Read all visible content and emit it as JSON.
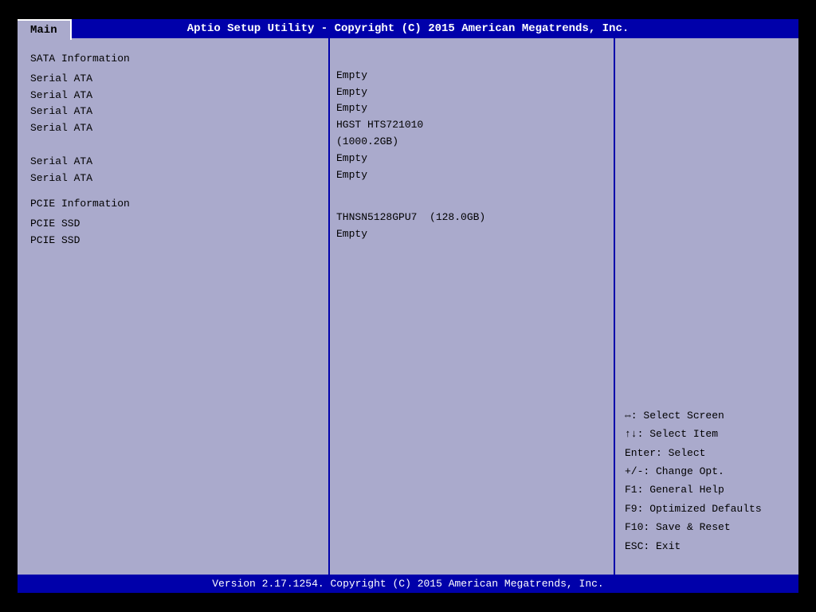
{
  "header": {
    "title": "Aptio Setup Utility - Copyright (C) 2015 American Megatrends, Inc.",
    "tab_main": "Main"
  },
  "footer": {
    "text": "Version 2.17.1254. Copyright (C) 2015 American Megatrends, Inc."
  },
  "left_panel": {
    "sata_section": "SATA Information",
    "sata_ports": [
      "Serial ATA",
      "Serial ATA",
      "Serial ATA",
      "Serial ATA",
      "",
      "Serial ATA",
      "Serial ATA"
    ],
    "pcie_section": "PCIE Information",
    "pcie_ports": [
      "PCIE SSD",
      "PCIE SSD"
    ]
  },
  "center_panel": {
    "sata_values": [
      "Empty",
      "Empty",
      "Empty",
      "HGST HTS721010",
      "(1000.2GB)",
      "Empty",
      "Empty"
    ],
    "pcie_values": [
      "THNSN5128GPU7  (128.0GB)",
      "Empty"
    ]
  },
  "right_panel": {
    "keys": [
      "⇔: Select Screen",
      "↑↓: Select Item",
      "Enter: Select",
      "+/-: Change Opt.",
      "F1: General Help",
      "F9: Optimized Defaults",
      "F10: Save & Reset",
      "ESC: Exit"
    ]
  }
}
